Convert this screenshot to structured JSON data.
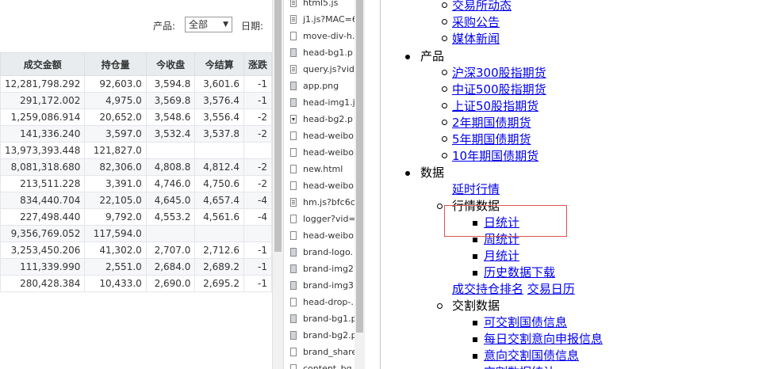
{
  "filter": {
    "product_label": "产品:",
    "product_value": "全部",
    "date_label": "日期:"
  },
  "table": {
    "headers": [
      "成交金额",
      "持仓量",
      "今收盘",
      "今结算",
      "涨跌"
    ],
    "rows": [
      [
        "12,281,798.292",
        "92,603.0",
        "3,594.8",
        "3,601.6",
        "-1"
      ],
      [
        "291,172.002",
        "4,975.0",
        "3,569.8",
        "3,576.4",
        "-1"
      ],
      [
        "1,259,086.914",
        "20,652.0",
        "3,548.6",
        "3,556.4",
        "-2"
      ],
      [
        "141,336.240",
        "3,597.0",
        "3,532.4",
        "3,537.8",
        "-2"
      ],
      [
        "13,973,393.448",
        "121,827.0",
        "",
        "",
        ""
      ],
      [
        "8,081,318.680",
        "82,306.0",
        "4,808.8",
        "4,812.4",
        "-2"
      ],
      [
        "213,511.228",
        "3,391.0",
        "4,746.0",
        "4,750.6",
        "-2"
      ],
      [
        "834,440.704",
        "22,105.0",
        "4,645.0",
        "4,657.4",
        "-4"
      ],
      [
        "227,498.440",
        "9,792.0",
        "4,553.2",
        "4,561.6",
        "-4"
      ],
      [
        "9,356,769.052",
        "117,594.0",
        "",
        "",
        ""
      ],
      [
        "3,253,450.206",
        "41,302.0",
        "2,707.0",
        "2,712.6",
        "-1"
      ],
      [
        "111,339.990",
        "2,551.0",
        "2,684.0",
        "2,689.2",
        "-1"
      ],
      [
        "280,428.384",
        "10,433.0",
        "2,690.0",
        "2,695.2",
        "-1"
      ]
    ]
  },
  "files": [
    {
      "name": "html5.js",
      "icon": "js-file-icon"
    },
    {
      "name": "j1.js?MAC=6",
      "icon": "js-file-icon"
    },
    {
      "name": "move-div-h.",
      "icon": "file-icon"
    },
    {
      "name": "head-bg1.p",
      "icon": "image-file-icon"
    },
    {
      "name": "query.js?vid",
      "icon": "js-file-icon"
    },
    {
      "name": "app.png",
      "icon": "image-file-icon"
    },
    {
      "name": "head-img1.j",
      "icon": "image-file-icon"
    },
    {
      "name": "head-bg2.p",
      "icon": "dropdown-icon"
    },
    {
      "name": "head-weibo",
      "icon": "file-icon"
    },
    {
      "name": "head-weibo",
      "icon": "file-icon"
    },
    {
      "name": "new.html",
      "icon": "file-icon"
    },
    {
      "name": "head-weibo",
      "icon": "file-icon"
    },
    {
      "name": "hm.js?bfc6c",
      "icon": "js-file-icon"
    },
    {
      "name": "logger?vid=",
      "icon": "file-icon"
    },
    {
      "name": "head-weibo",
      "icon": "file-icon"
    },
    {
      "name": "brand-logo.",
      "icon": "image-file-icon"
    },
    {
      "name": "brand-img2",
      "icon": "image-file-icon"
    },
    {
      "name": "brand-img3",
      "icon": "image-file-icon"
    },
    {
      "name": "head-drop-.",
      "icon": "file-icon"
    },
    {
      "name": "brand-bg1.p",
      "icon": "image-file-icon"
    },
    {
      "name": "brand-bg2.p",
      "icon": "image-file-icon"
    },
    {
      "name": "brand_share",
      "icon": "file-icon"
    },
    {
      "name": "content_bg",
      "icon": "file-icon"
    }
  ],
  "nav": {
    "top_links": [
      "交易所动态",
      "采购公告",
      "媒体新闻"
    ],
    "products_label": "产品",
    "products": [
      "沪深300股指期货",
      "中证500股指期货",
      "上证50股指期货",
      "2年期国债期货",
      "5年期国债期货",
      "10年期国债期货"
    ],
    "data_label": "数据",
    "delayed_quotes": "延时行情",
    "market_data_label": "行情数据",
    "market_data_items": [
      "日统计",
      "周统计",
      "月统计",
      "历史数据下载"
    ],
    "ranking_link": "成交持仓排名",
    "calendar_link": "交易日历",
    "delivery_label": "交割数据",
    "delivery_items": [
      "可交割国债信息",
      "每日交割意向申报信息",
      "意向交割国债信息",
      "交割数据统计"
    ]
  },
  "colors": {
    "link": "#0000ee",
    "highlight_border": "#d9534f",
    "table_header_bg": "#e9ecef"
  }
}
